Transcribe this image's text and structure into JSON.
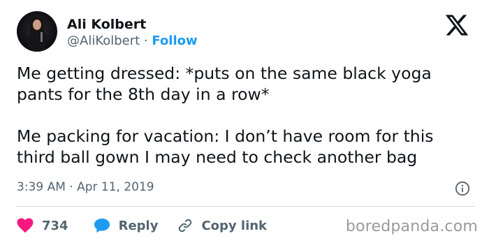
{
  "author": {
    "name": "Ali Kolbert",
    "handle": "@AliKolbert",
    "separator": " · ",
    "follow_label": "Follow"
  },
  "tweet": {
    "lines_first": [
      "Me getting dressed: *puts on the same black yoga",
      "pants for the 8th day in a row*"
    ],
    "lines_second": [
      "Me packing for vacation: I don’t have room for this",
      "third ball gown I may need to check another bag"
    ],
    "timestamp": "3:39 AM · Apr 11, 2019"
  },
  "actions": {
    "like_count": "734",
    "reply_label": "Reply",
    "copy_link_label": "Copy link"
  },
  "icons": {
    "brand": "x-logo-icon",
    "info": "info-icon",
    "like": "heart-icon",
    "reply": "speech-bubble-icon",
    "copy_link": "link-icon"
  },
  "colors": {
    "text": "#0f1419",
    "secondary": "#536471",
    "accent": "#1d9bf0",
    "like": "#f91880",
    "divider": "#cfd9de",
    "watermark": "#9a9a9a"
  },
  "watermark": "boredpanda.com"
}
